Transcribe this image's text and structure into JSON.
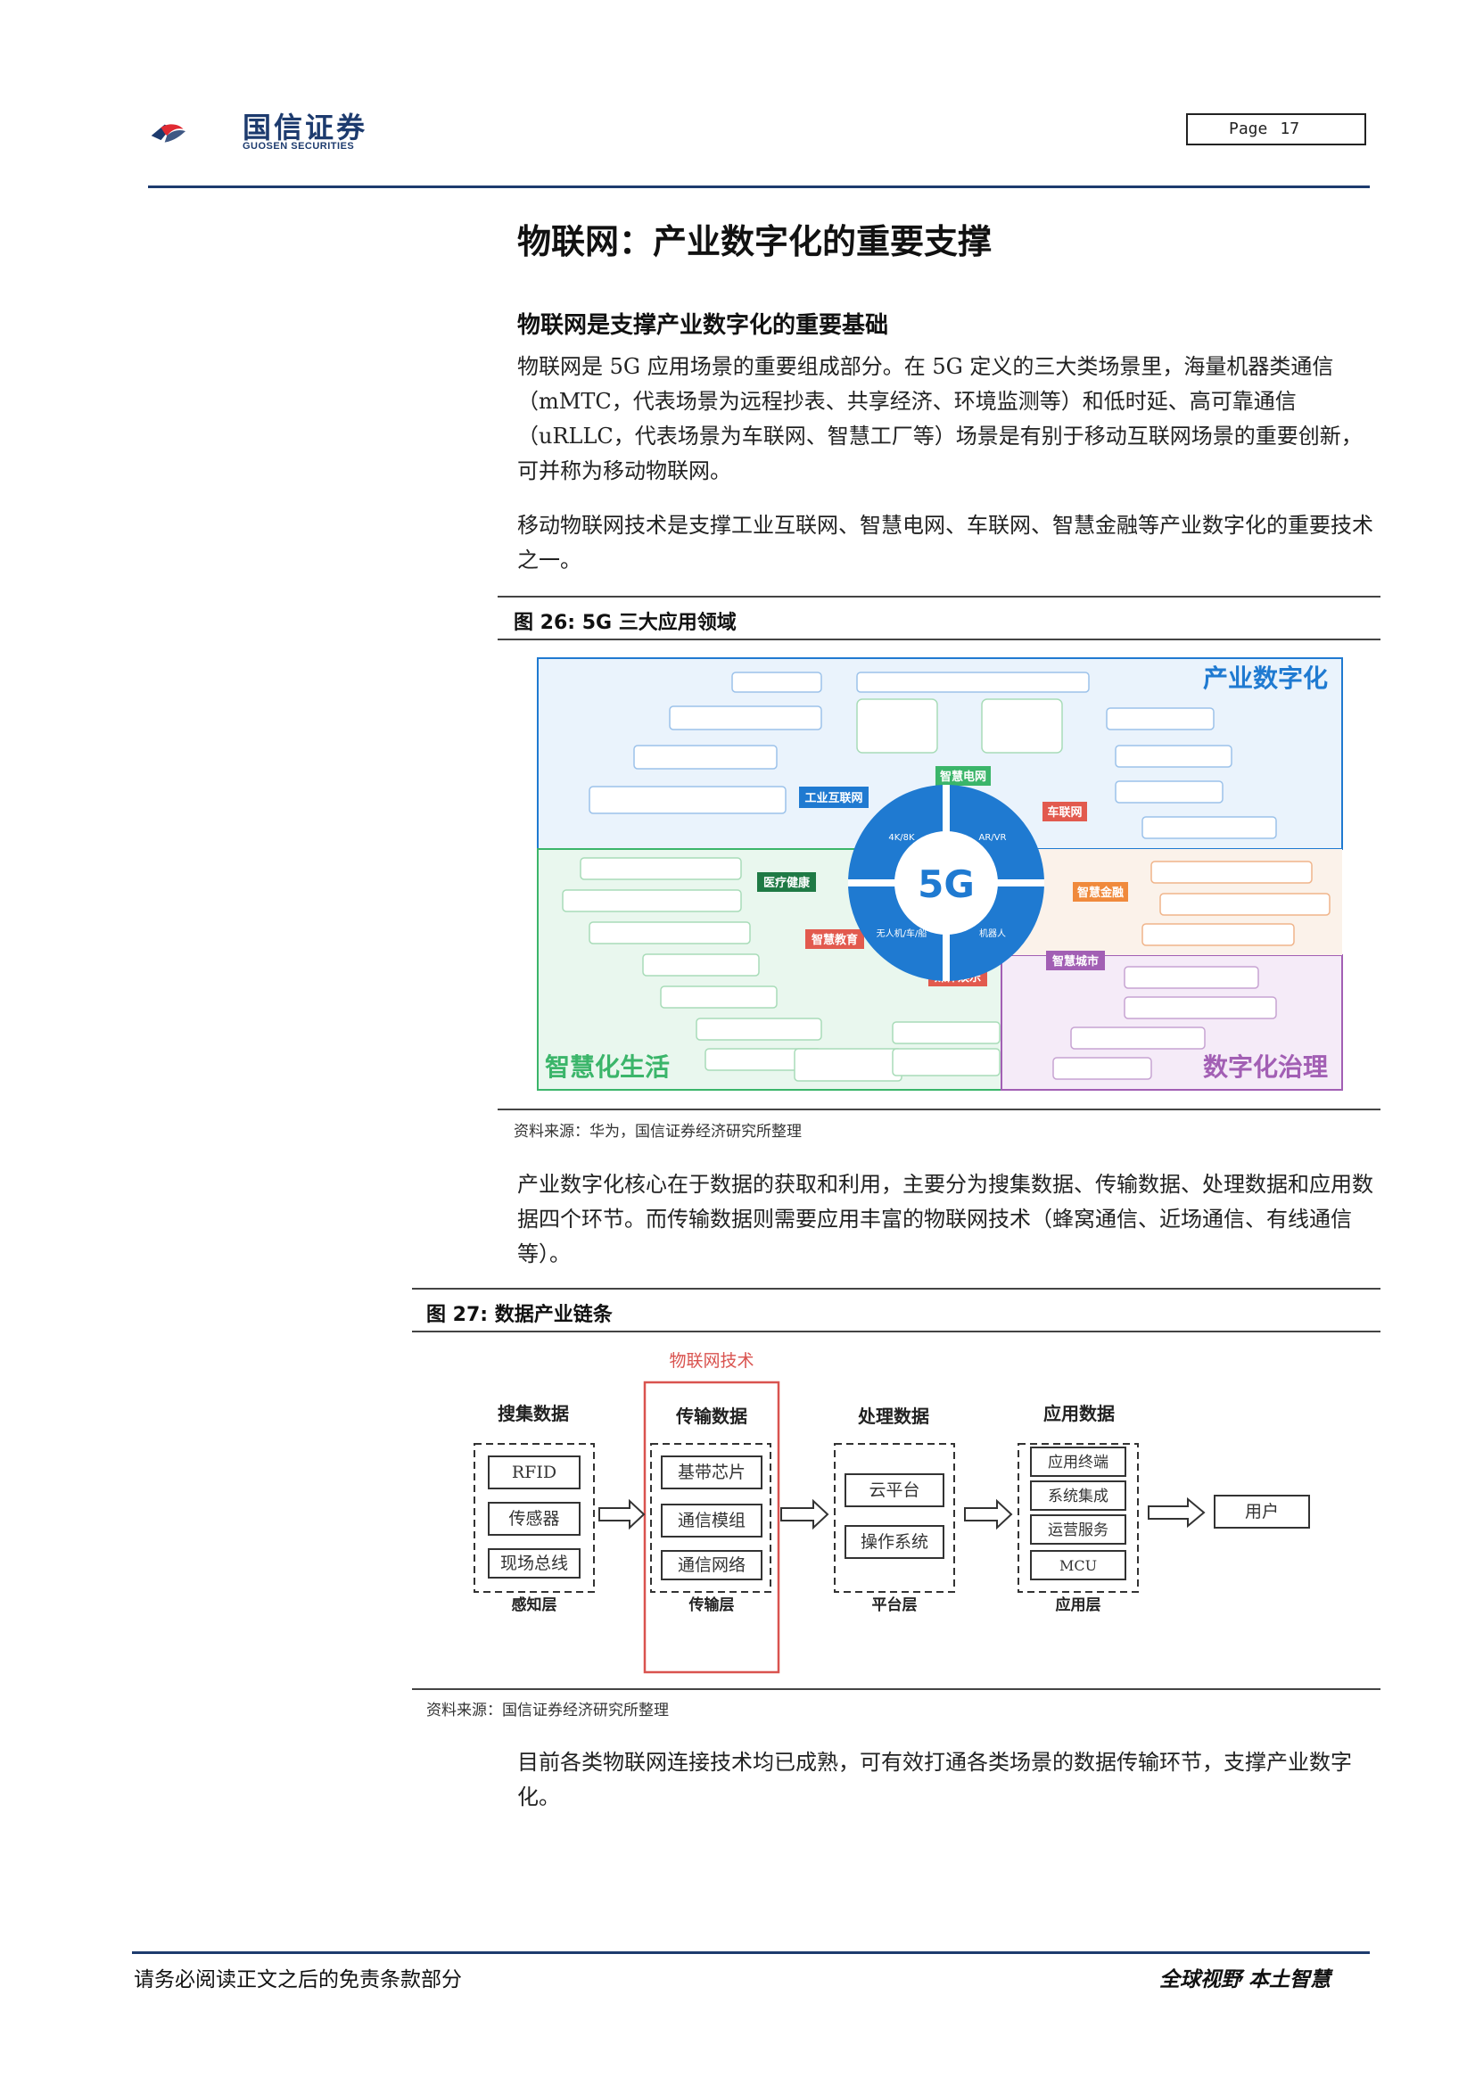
{
  "header": {
    "logo_text": "国信证券",
    "logo_sub": "GUOSEN SECURITIES",
    "page_label": "Page",
    "page_number": "17"
  },
  "title": "物联网：产业数字化的重要支撑",
  "subtitle": "物联网是支撑产业数字化的重要基础",
  "paragraphs": [
    "物联网是 5G 应用场景的重要组成部分。在 5G 定义的三大类场景里，海量机器类通信（mMTC，代表场景为远程抄表、共享经济、环境监测等）和低时延、高可靠通信（uRLLC，代表场景为车联网、智慧工厂等）场景是有别于移动互联网场景的重要创新，可并称为移动物联网。",
    "移动物联网技术是支撑工业互联网、智慧电网、车联网、智慧金融等产业数字化的重要技术之一。",
    "产业数字化核心在于数据的获取和利用，主要分为搜集数据、传输数据、处理数据和应用数据四个环节。而传输数据则需要应用丰富的物联网技术（蜂窝通信、近场通信、有线通信等）。",
    "目前各类物联网连接技术均已成熟，可有效打通各类场景的数据传输环节，支撑产业数字化。"
  ],
  "figure26": {
    "caption": "图 26:  5G 三大应用领域",
    "source": "资料来源：华为，国信证券经济研究所整理",
    "center": "5G",
    "quadrants": [
      "4K/8K",
      "AR/VR",
      "无人机/车/船",
      "机器人"
    ],
    "regions": {
      "top_right": "产业数字化",
      "bottom_left": "智慧化生活",
      "bottom_right": "数字化治理"
    },
    "domains": [
      "智慧电网",
      "工业互联网",
      "车联网",
      "医疗健康",
      "智慧金融",
      "智慧教育",
      "媒体娱乐",
      "智慧城市"
    ],
    "colors": {
      "blue": "#1f7ad1",
      "green": "#3bb56a",
      "purple": "#a25fb4",
      "red": "#e25a4e",
      "orange": "#f08a3c"
    }
  },
  "figure27": {
    "caption": "图 27:  数据产业链条",
    "source": "资料来源：国信证券经济研究所整理",
    "highlight_label": "物联网技术",
    "stages": [
      {
        "title": "搜集数据",
        "items": [
          "RFID",
          "传感器",
          "现场总线"
        ],
        "layer": "感知层"
      },
      {
        "title": "传输数据",
        "items": [
          "基带芯片",
          "通信模组",
          "通信网络"
        ],
        "layer": "传输层"
      },
      {
        "title": "处理数据",
        "items": [
          "云平台",
          "操作系统"
        ],
        "layer": "平台层"
      },
      {
        "title": "应用数据",
        "items": [
          "应用终端",
          "系统集成",
          "运营服务",
          "MCU"
        ],
        "layer": "应用层"
      }
    ],
    "user": "用户"
  },
  "footer": {
    "left": "请务必阅读正文之后的免责条款部分",
    "right": "全球视野  本土智慧"
  }
}
